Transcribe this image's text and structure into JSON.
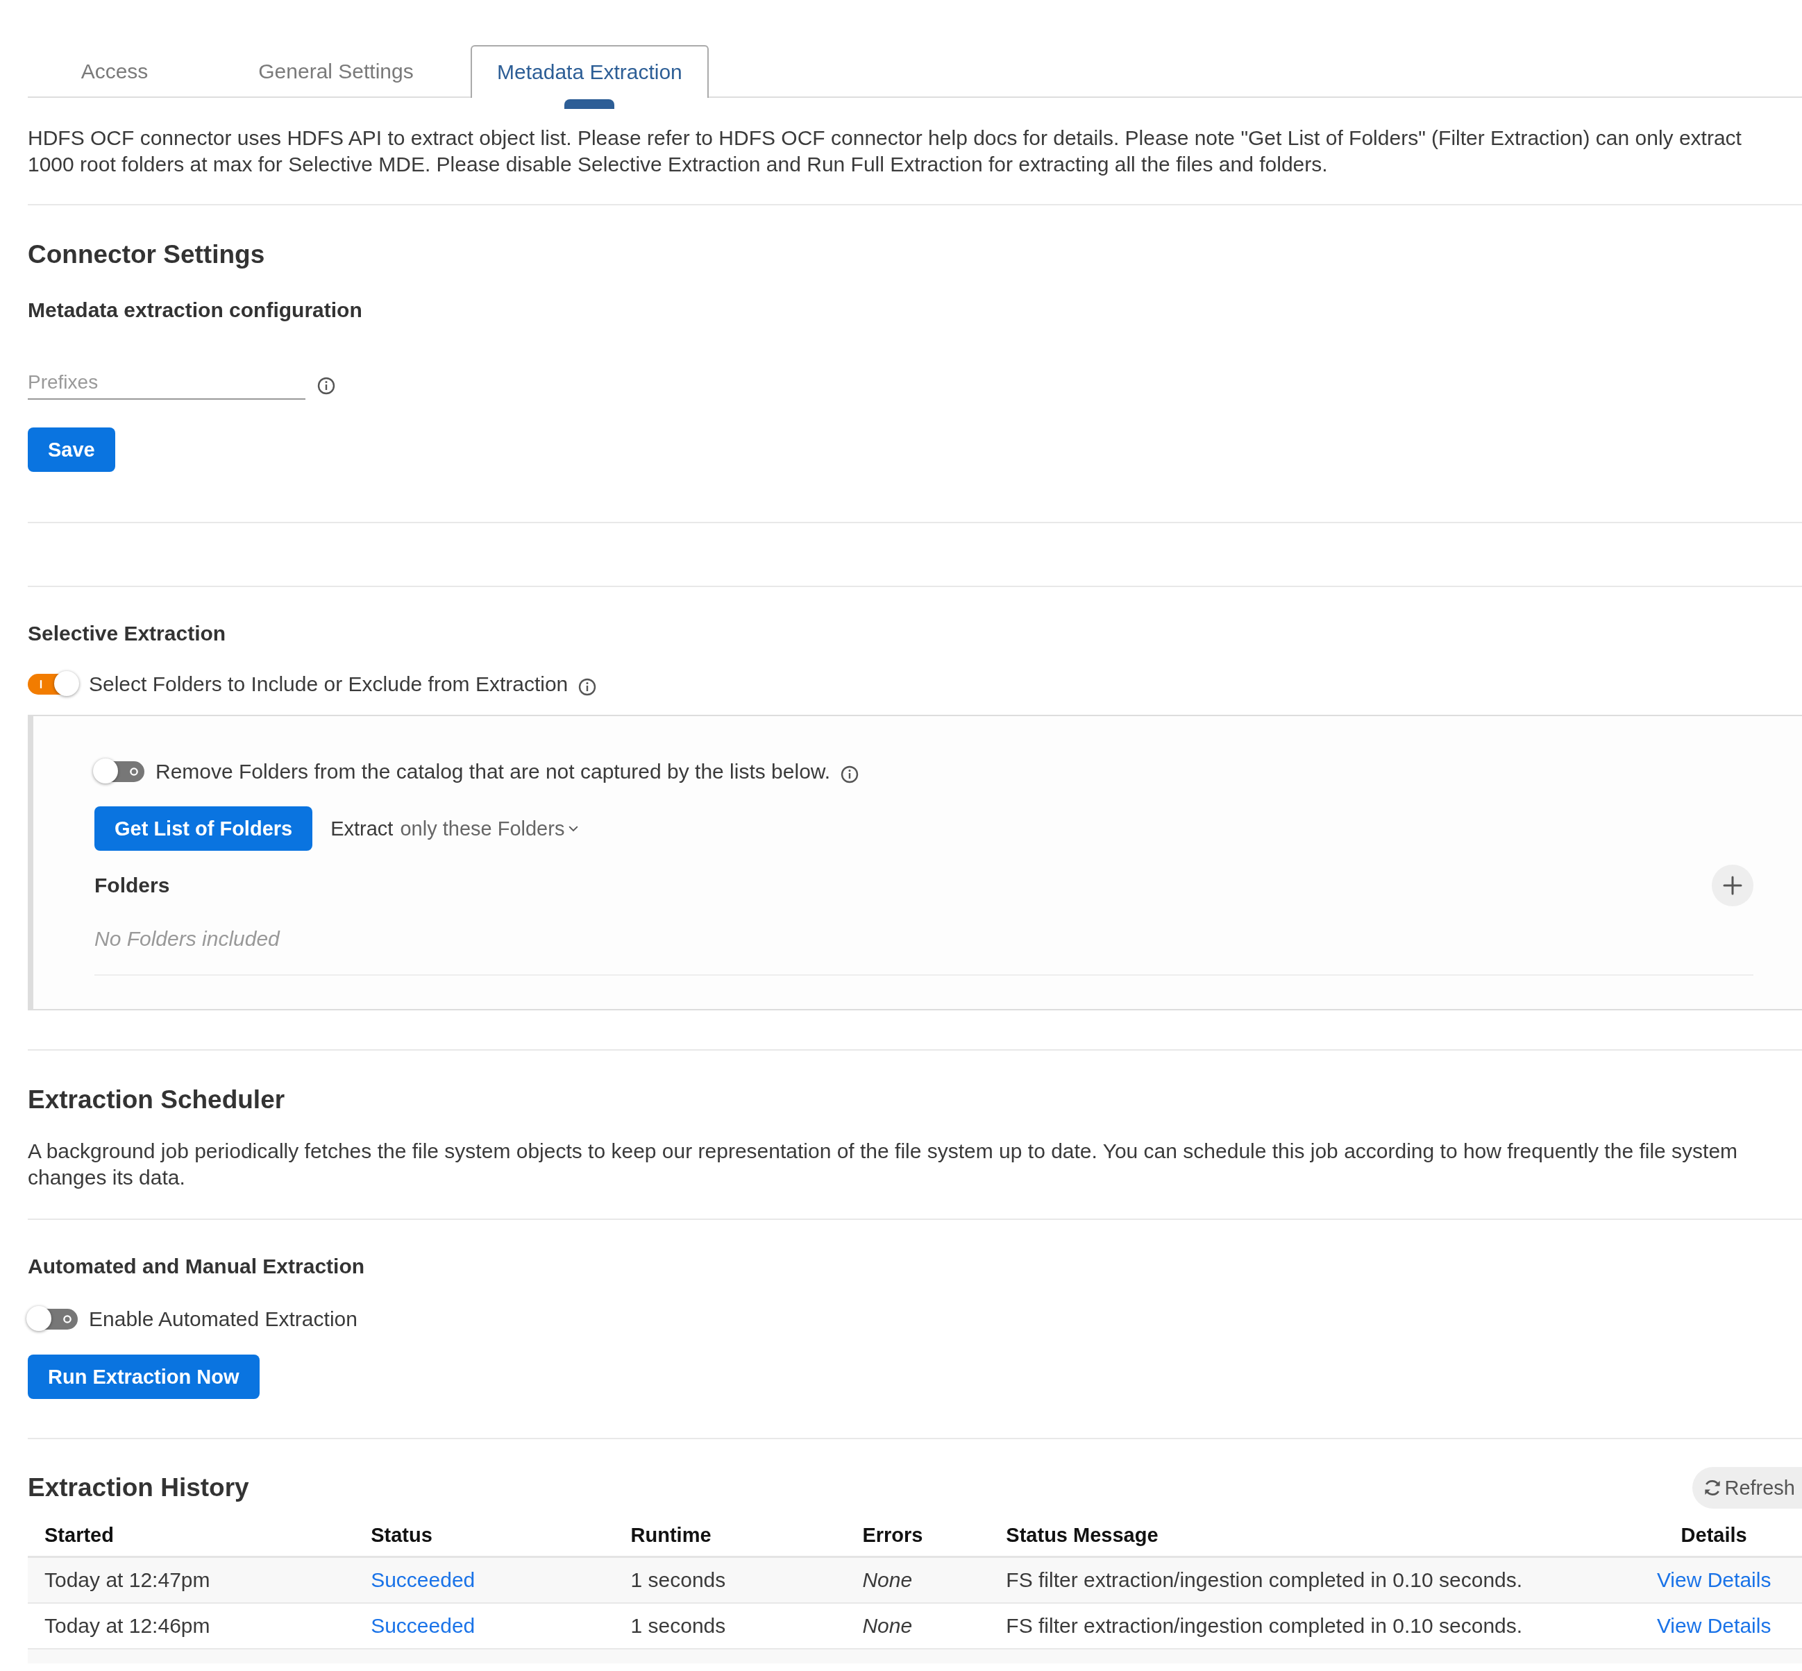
{
  "tabs": [
    {
      "label": "Access",
      "selected": false
    },
    {
      "label": "General Settings",
      "selected": false
    },
    {
      "label": "Metadata Extraction",
      "selected": true
    }
  ],
  "intro": "HDFS OCF connector uses HDFS API to extract object list. Please refer to HDFS OCF connector help docs for details. Please note \"Get List of Folders\" (Filter Extraction) can only extract 1000 root folders at max for Selective MDE. Please disable Selective Extraction and Run Full Extraction for extracting all the files and folders.",
  "connector_settings": {
    "title": "Connector Settings",
    "subtitle": "Metadata extraction configuration",
    "prefixes_field": {
      "placeholder": "Prefixes"
    },
    "save_button": "Save"
  },
  "selective_extraction": {
    "title": "Selective Extraction",
    "toggle": {
      "label": "Select Folders to Include or Exclude from Extraction",
      "on": true
    },
    "panel": {
      "remove_toggle": {
        "label": "Remove Folders from the catalog that are not captured by the lists below.",
        "on": false
      },
      "get_list_button": "Get List of Folders",
      "extract_mode": {
        "prefix": "Extract",
        "value": "only these Folders"
      },
      "folders": {
        "title": "Folders",
        "empty_text": "No Folders included"
      }
    }
  },
  "scheduler": {
    "title": "Extraction Scheduler",
    "description": "A background job periodically fetches the file system objects to keep our representation of the file system up to date. You can schedule this job according to how frequently the file system changes its data."
  },
  "automated": {
    "title": "Automated and Manual Extraction",
    "toggle": {
      "label": "Enable Automated Extraction",
      "on": false
    },
    "run_button": "Run Extraction Now"
  },
  "history": {
    "title": "Extraction History",
    "refresh_button": "Refresh",
    "columns": [
      "Started",
      "Status",
      "Runtime",
      "Errors",
      "Status Message",
      "Details"
    ],
    "rows": [
      {
        "started": "Today at 12:47pm",
        "status": "Succeeded",
        "runtime": "1 seconds",
        "errors": "None",
        "message": "FS filter extraction/ingestion completed in 0.10 seconds.",
        "details": "View Details"
      },
      {
        "started": "Today at 12:46pm",
        "status": "Succeeded",
        "runtime": "1 seconds",
        "errors": "None",
        "message": "FS filter extraction/ingestion completed in 0.10 seconds.",
        "details": "View Details"
      }
    ]
  }
}
